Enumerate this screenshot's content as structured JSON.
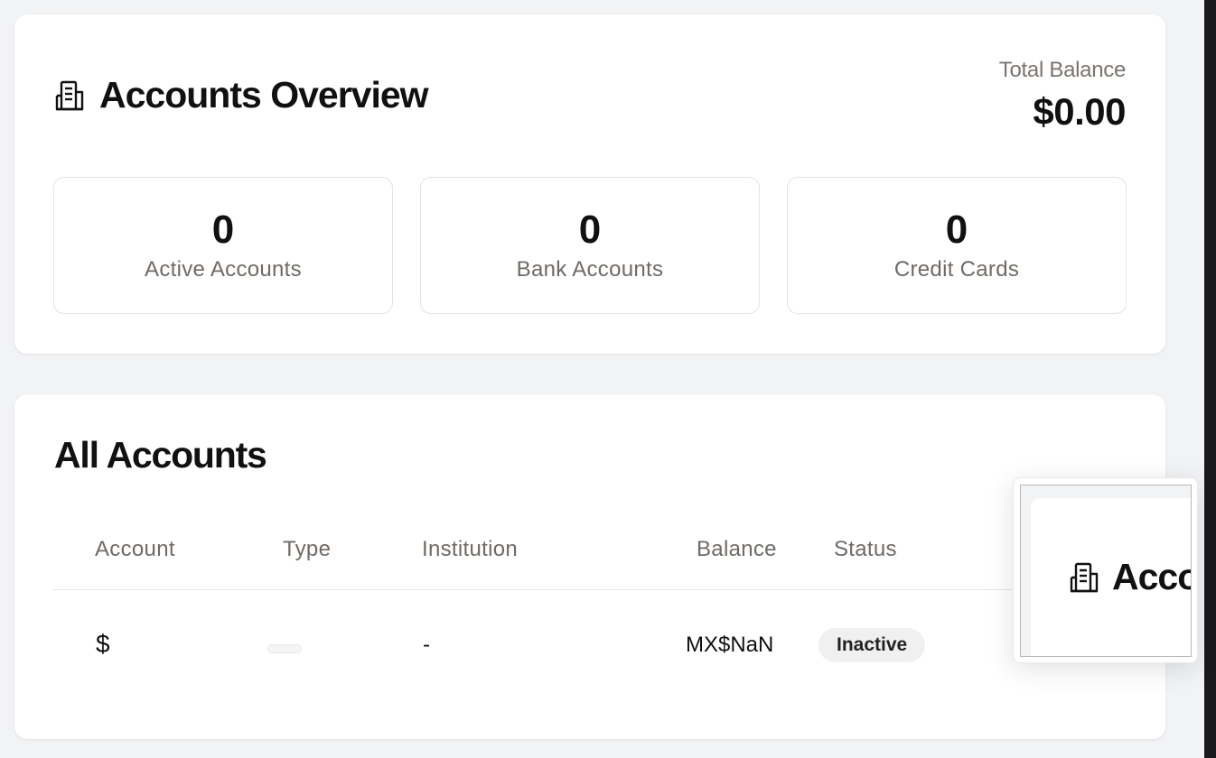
{
  "overview": {
    "title": "Accounts Overview",
    "icon": "building-icon",
    "total_label": "Total Balance",
    "total_value": "$0.00",
    "stats": [
      {
        "value": "0",
        "label": "Active Accounts"
      },
      {
        "value": "0",
        "label": "Bank Accounts"
      },
      {
        "value": "0",
        "label": "Credit Cards"
      }
    ]
  },
  "accounts": {
    "title": "All Accounts",
    "columns": [
      "Account",
      "Type",
      "Institution",
      "Balance",
      "Status"
    ],
    "rows": [
      {
        "account": "$",
        "type": "",
        "institution": "-",
        "balance": "MX$NaN",
        "status": "Inactive"
      }
    ]
  },
  "thumbnail": {
    "title": "Accounts Overview",
    "icon": "building-icon"
  }
}
